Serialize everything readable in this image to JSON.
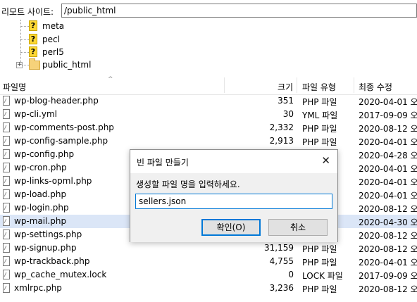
{
  "remote_site": {
    "label": "리모트 사이트:",
    "path": "/public_html"
  },
  "tree": {
    "items": [
      {
        "label": "meta",
        "icon": "unknown-folder-icon"
      },
      {
        "label": "pecl",
        "icon": "unknown-folder-icon"
      },
      {
        "label": "perl5",
        "icon": "unknown-folder-icon"
      },
      {
        "label": "public_html",
        "icon": "folder-icon"
      }
    ],
    "expander": "+"
  },
  "columns": {
    "name": "파일명",
    "size": "크기",
    "type": "파일 유형",
    "modified": "최종 수정"
  },
  "sort_indicator": "^",
  "files": [
    {
      "name": "wp-blog-header.php",
      "size": "351",
      "type": "PHP 파일",
      "date": "2020-04-01 오"
    },
    {
      "name": "wp-cli.yml",
      "size": "30",
      "type": "YML 파일",
      "date": "2017-09-09 오"
    },
    {
      "name": "wp-comments-post.php",
      "size": "2,332",
      "type": "PHP 파일",
      "date": "2020-08-12 오"
    },
    {
      "name": "wp-config-sample.php",
      "size": "2,913",
      "type": "PHP 파일",
      "date": "2020-04-01 오"
    },
    {
      "name": "wp-config.php",
      "size": "",
      "type": "",
      "date": "2020-04-28 오"
    },
    {
      "name": "wp-cron.php",
      "size": "",
      "type": "",
      "date": "2020-04-01 오"
    },
    {
      "name": "wp-links-opml.php",
      "size": "",
      "type": "",
      "date": "2020-04-01 오"
    },
    {
      "name": "wp-load.php",
      "size": "",
      "type": "",
      "date": "2020-04-01 오"
    },
    {
      "name": "wp-login.php",
      "size": "",
      "type": "",
      "date": "2020-08-12 오"
    },
    {
      "name": "wp-mail.php",
      "size": "",
      "type": "",
      "date": "2020-04-30 오"
    },
    {
      "name": "wp-settings.php",
      "size": "",
      "type": "",
      "date": "2020-08-12 오"
    },
    {
      "name": "wp-signup.php",
      "size": "31,159",
      "type": "PHP 파일",
      "date": "2020-08-12 오"
    },
    {
      "name": "wp-trackback.php",
      "size": "4,755",
      "type": "PHP 파일",
      "date": "2020-04-01 오"
    },
    {
      "name": "wp_cache_mutex.lock",
      "size": "0",
      "type": "LOCK 파일",
      "date": "2017-09-09 오"
    },
    {
      "name": "xmlrpc.php",
      "size": "3,236",
      "type": "PHP 파일",
      "date": "2020-08-12 오"
    }
  ],
  "selected_row": 9,
  "dialog": {
    "title": "빈 파일 만들기",
    "close_glyph": "✕",
    "prompt": "생성할 파일 명을 입력하세요.",
    "input_value": "sellers.json",
    "ok_label": "확인(O)",
    "cancel_label": "취소"
  },
  "colors": {
    "selection": "#dbe6f7",
    "accent": "#0078d7"
  }
}
